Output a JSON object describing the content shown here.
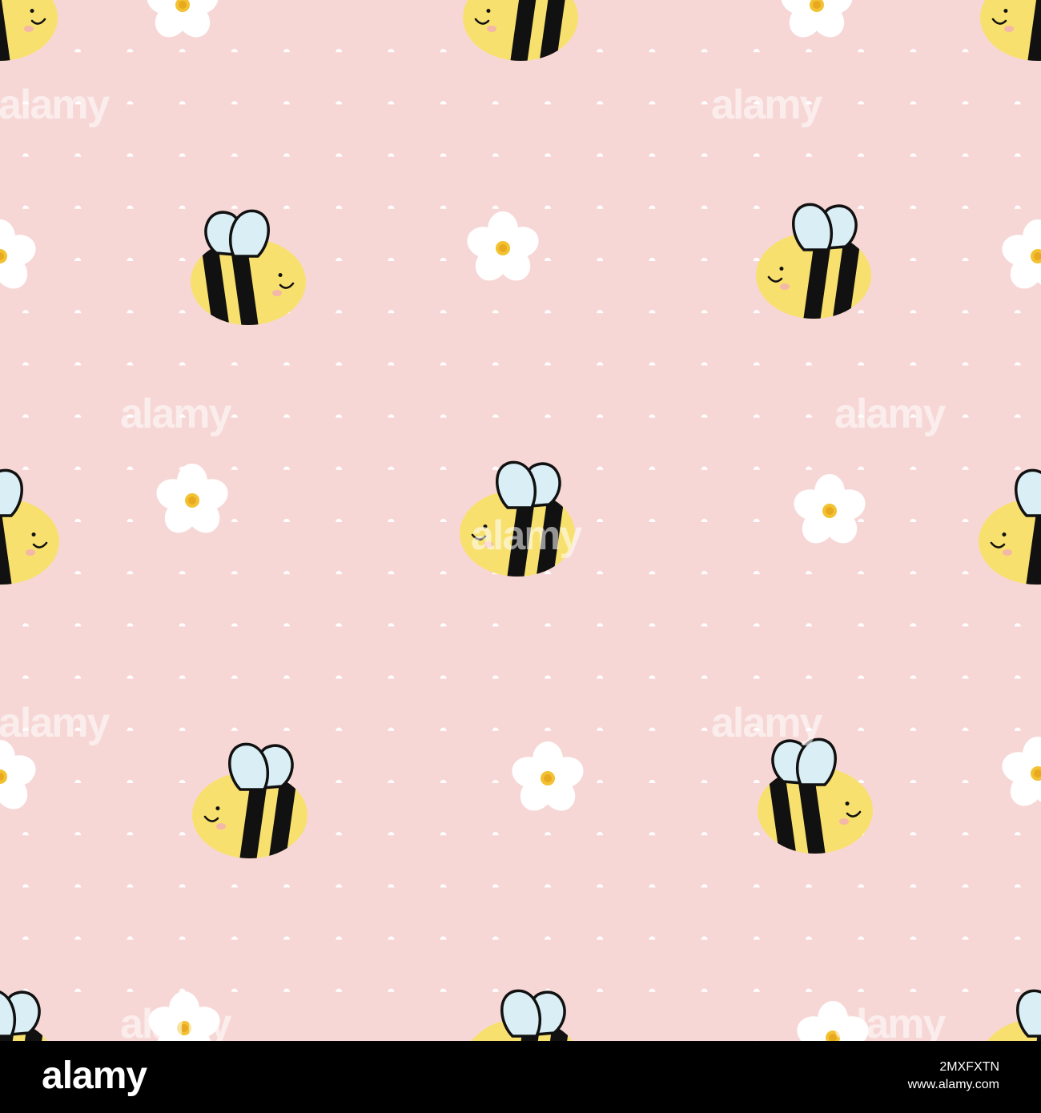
{
  "image": {
    "description_colors": {
      "background": "#f6d7d6",
      "dot": "#ffffff",
      "bee_body": "#f8e06f",
      "bee_stripe": "#111111",
      "bee_wing": "#d9eef5",
      "flower_petal": "#ffffff",
      "flower_center": "#f2c232",
      "blush": "#f4b8a8",
      "footer_bg": "#000000"
    },
    "watermark": "alamy"
  },
  "footer": {
    "logo": "alamy",
    "image_id": "2MXFXTN",
    "url": "www.alamy.com"
  }
}
